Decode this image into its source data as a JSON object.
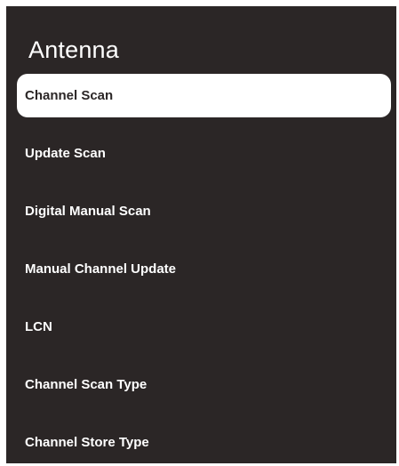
{
  "header": {
    "title": "Antenna"
  },
  "menu": {
    "selected_index": 0,
    "items": [
      {
        "label": "Channel Scan"
      },
      {
        "label": "Update Scan"
      },
      {
        "label": "Digital Manual Scan"
      },
      {
        "label": "Manual Channel Update"
      },
      {
        "label": "LCN"
      },
      {
        "label": "Channel Scan Type"
      },
      {
        "label": "Channel Store Type"
      }
    ]
  },
  "colors": {
    "panel_background": "#2b2626",
    "text": "#ffffff",
    "selected_background": "#ffffff",
    "selected_text": "#2b2626"
  }
}
